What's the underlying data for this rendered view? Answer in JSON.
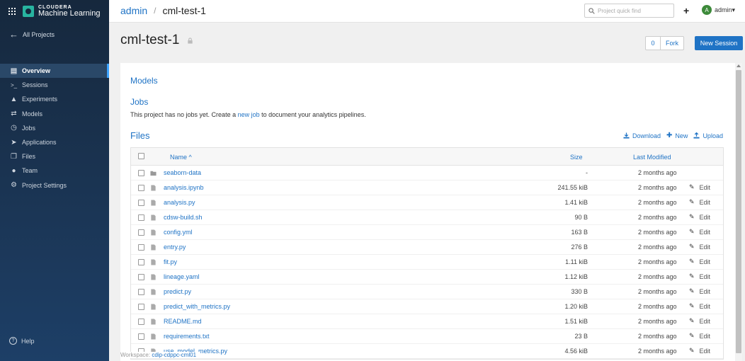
{
  "brand": {
    "line1": "CLOUDERA",
    "line2": "Machine Learning"
  },
  "sidebar": {
    "all_projects": "All Projects",
    "items": [
      {
        "label": "Overview",
        "icon": "overview-icon",
        "active": true
      },
      {
        "label": "Sessions",
        "icon": "terminal-icon",
        "active": false
      },
      {
        "label": "Experiments",
        "icon": "flask-icon",
        "active": false
      },
      {
        "label": "Models",
        "icon": "arrows-exchange-icon",
        "active": false
      },
      {
        "label": "Jobs",
        "icon": "clock-icon",
        "active": false
      },
      {
        "label": "Applications",
        "icon": "rocket-icon",
        "active": false
      },
      {
        "label": "Files",
        "icon": "files-icon",
        "active": false
      },
      {
        "label": "Team",
        "icon": "team-icon",
        "active": false
      },
      {
        "label": "Project Settings",
        "icon": "gear-icon",
        "active": false
      }
    ],
    "help": "Help"
  },
  "topbar": {
    "breadcrumb_user": "admin",
    "breadcrumb_separator": "/",
    "breadcrumb_project": "cml-test-1",
    "search_placeholder": "Project quick find",
    "plus": "+",
    "avatar_letter": "A",
    "user_name": "admin",
    "user_caret": "▾"
  },
  "project": {
    "title": "cml-test-1",
    "fork_count": "0",
    "fork_label": "Fork",
    "new_session_label": "New Session"
  },
  "models": {
    "heading": "Models"
  },
  "jobs": {
    "heading": "Jobs",
    "text_before": "This project has no jobs yet. Create a ",
    "link": "new job",
    "text_after": " to document your analytics pipelines."
  },
  "files": {
    "heading": "Files",
    "download_label": "Download",
    "new_label": "New",
    "upload_label": "Upload",
    "columns": {
      "name": "Name",
      "sort_caret": "^",
      "size": "Size",
      "modified": "Last Modified"
    },
    "edit_label": "Edit",
    "rows": [
      {
        "name": "seaborn-data",
        "type": "folder",
        "size": "-",
        "modified": "2 months ago",
        "editable": false
      },
      {
        "name": "analysis.ipynb",
        "type": "file",
        "size": "241.55 kiB",
        "modified": "2 months ago",
        "editable": true
      },
      {
        "name": "analysis.py",
        "type": "file",
        "size": "1.41 kiB",
        "modified": "2 months ago",
        "editable": true
      },
      {
        "name": "cdsw-build.sh",
        "type": "file",
        "size": "90 B",
        "modified": "2 months ago",
        "editable": true
      },
      {
        "name": "config.yml",
        "type": "file",
        "size": "163 B",
        "modified": "2 months ago",
        "editable": true
      },
      {
        "name": "entry.py",
        "type": "file",
        "size": "276 B",
        "modified": "2 months ago",
        "editable": true
      },
      {
        "name": "fit.py",
        "type": "file",
        "size": "1.11 kiB",
        "modified": "2 months ago",
        "editable": true
      },
      {
        "name": "lineage.yaml",
        "type": "file",
        "size": "1.12 kiB",
        "modified": "2 months ago",
        "editable": true
      },
      {
        "name": "predict.py",
        "type": "file",
        "size": "330 B",
        "modified": "2 months ago",
        "editable": true
      },
      {
        "name": "predict_with_metrics.py",
        "type": "file",
        "size": "1.20 kiB",
        "modified": "2 months ago",
        "editable": true
      },
      {
        "name": "README.md",
        "type": "file",
        "size": "1.51 kiB",
        "modified": "2 months ago",
        "editable": true
      },
      {
        "name": "requirements.txt",
        "type": "file",
        "size": "23 B",
        "modified": "2 months ago",
        "editable": true
      },
      {
        "name": "use_model_metrics.py",
        "type": "file",
        "size": "4.56 kiB",
        "modified": "2 months ago",
        "editable": true
      }
    ]
  },
  "workspace": {
    "label": "Workspace:",
    "value": "cdip-cdppc-cml01"
  },
  "colors": {
    "accent": "#1f73c5",
    "sidebar": "#16283d",
    "active_nav": "#2a4868"
  }
}
